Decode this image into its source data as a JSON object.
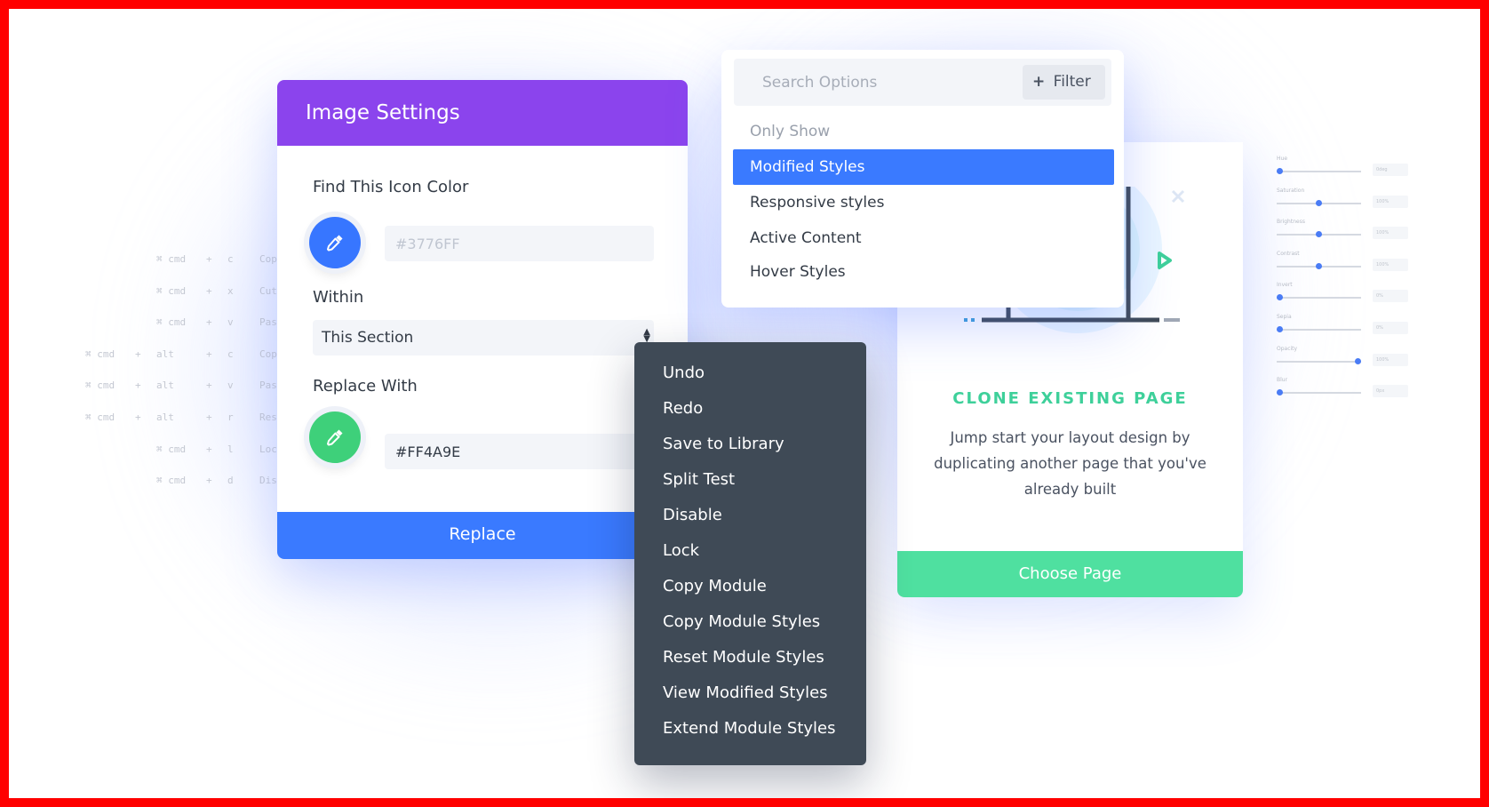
{
  "shortcuts": [
    {
      "keys": [
        "⌘ cmd",
        "+",
        "c"
      ],
      "label": "Cop"
    },
    {
      "keys": [
        "⌘ cmd",
        "+",
        "x"
      ],
      "label": "Cut"
    },
    {
      "keys": [
        "⌘ cmd",
        "+",
        "v"
      ],
      "label": "Pas"
    },
    {
      "keys": [
        "⌘ cmd",
        "+",
        "alt",
        "+",
        "c"
      ],
      "label": "Cop"
    },
    {
      "keys": [
        "⌘ cmd",
        "+",
        "alt",
        "+",
        "v"
      ],
      "label": "Pas"
    },
    {
      "keys": [
        "⌘ cmd",
        "+",
        "alt",
        "+",
        "r"
      ],
      "label": "Res"
    },
    {
      "keys": [
        "⌘ cmd",
        "+",
        "l"
      ],
      "label": "Loc"
    },
    {
      "keys": [
        "⌘ cmd",
        "+",
        "d"
      ],
      "label": "Dis"
    }
  ],
  "image_settings": {
    "title": "Image Settings",
    "find_label": "Find This Icon Color",
    "find_value": "#3776FF",
    "within_label": "Within",
    "within_value": "This Section",
    "replace_label": "Replace With",
    "replace_value": "#FF4A9E",
    "replace_button": "Replace"
  },
  "search_options": {
    "placeholder": "Search Options",
    "filter_label": "Filter",
    "heading": "Only Show",
    "items": [
      "Modified Styles",
      "Responsive styles",
      "Active Content",
      "Hover Styles"
    ],
    "selected_index": 0
  },
  "clone_card": {
    "title": "CLONE EXISTING PAGE",
    "description": "Jump start your layout design by duplicating another page that you've already built",
    "button": "Choose Page"
  },
  "context_menu": {
    "items": [
      "Undo",
      "Redo",
      "Save to Library",
      "Split Test",
      "Disable",
      "Lock",
      "Copy Module",
      "Copy Module Styles",
      "Reset Module Styles",
      "View Modified Styles",
      "Extend Module Styles"
    ]
  },
  "sliders": [
    {
      "name": "Hue",
      "value": "0deg",
      "level": 0.0
    },
    {
      "name": "Saturation",
      "value": "100%",
      "level": 0.5
    },
    {
      "name": "Brightness",
      "value": "100%",
      "level": 0.5
    },
    {
      "name": "Contrast",
      "value": "100%",
      "level": 0.5
    },
    {
      "name": "Invert",
      "value": "0%",
      "level": 0.0
    },
    {
      "name": "Sepia",
      "value": "0%",
      "level": 0.0
    },
    {
      "name": "Opacity",
      "value": "100%",
      "level": 1.0
    },
    {
      "name": "Blur",
      "value": "0px",
      "level": 0.0
    }
  ],
  "colors": {
    "frame": "#ff0000",
    "header_purple": "#8b44ed",
    "primary_blue": "#3a7aff",
    "picker_blue": "#3776ff",
    "picker_green": "#3ed07a",
    "teal": "#3ed09a",
    "menu_dark": "#3f4a56"
  }
}
